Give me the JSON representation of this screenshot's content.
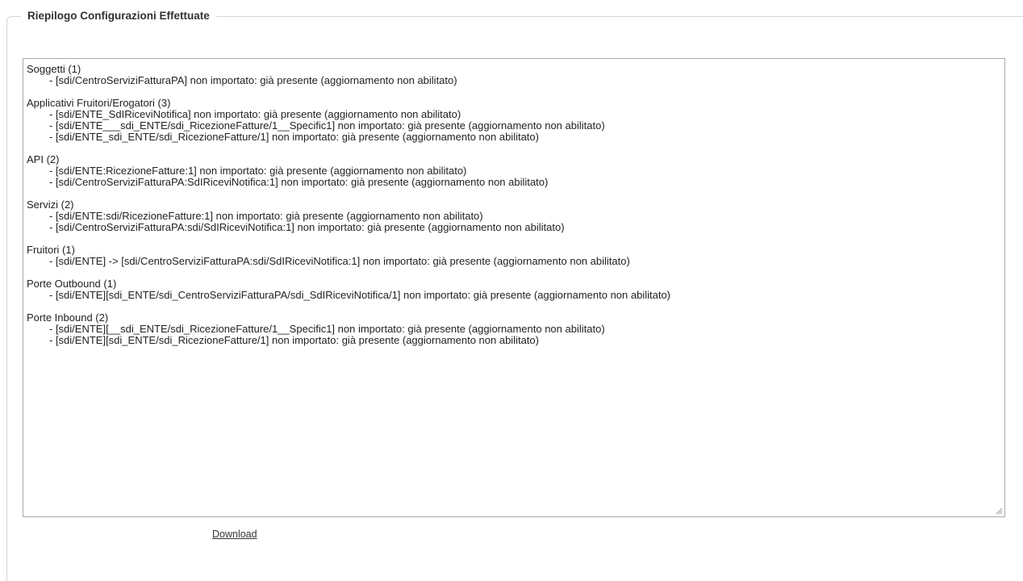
{
  "panel": {
    "legend": "Riepilogo Configurazioni Effettuate"
  },
  "summary": {
    "sections": [
      {
        "title": "Soggetti (1)",
        "items": [
          "- [sdi/CentroServiziFatturaPA] non importato: già presente (aggiornamento non abilitato)"
        ]
      },
      {
        "title": "Applicativi Fruitori/Erogatori (3)",
        "items": [
          "- [sdi/ENTE_SdIRiceviNotifica] non importato: già presente (aggiornamento non abilitato)",
          "- [sdi/ENTE___sdi_ENTE/sdi_RicezioneFatture/1__Specific1] non importato: già presente (aggiornamento non abilitato)",
          "- [sdi/ENTE_sdi_ENTE/sdi_RicezioneFatture/1] non importato: già presente (aggiornamento non abilitato)"
        ]
      },
      {
        "title": "API (2)",
        "items": [
          "- [sdi/ENTE:RicezioneFatture:1] non importato: già presente (aggiornamento non abilitato)",
          "- [sdi/CentroServiziFatturaPA:SdIRiceviNotifica:1] non importato: già presente (aggiornamento non abilitato)"
        ]
      },
      {
        "title": "Servizi (2)",
        "items": [
          "- [sdi/ENTE:sdi/RicezioneFatture:1] non importato: già presente (aggiornamento non abilitato)",
          "- [sdi/CentroServiziFatturaPA:sdi/SdIRiceviNotifica:1] non importato: già presente (aggiornamento non abilitato)"
        ]
      },
      {
        "title": "Fruitori (1)",
        "items": [
          "- [sdi/ENTE] -> [sdi/CentroServiziFatturaPA:sdi/SdIRiceviNotifica:1] non importato: già presente (aggiornamento non abilitato)"
        ]
      },
      {
        "title": "Porte Outbound (1)",
        "items": [
          "- [sdi/ENTE][sdi_ENTE/sdi_CentroServiziFatturaPA/sdi_SdIRiceviNotifica/1] non importato: già presente (aggiornamento non abilitato)"
        ]
      },
      {
        "title": "Porte Inbound (2)",
        "items": [
          "- [sdi/ENTE][__sdi_ENTE/sdi_RicezioneFatture/1__Specific1] non importato: già presente (aggiornamento non abilitato)",
          "- [sdi/ENTE][sdi_ENTE/sdi_RicezioneFatture/1] non importato: già presente (aggiornamento non abilitato)"
        ]
      }
    ],
    "resize_icon": "resize-grip-icon"
  },
  "actions": {
    "download_label": "Download"
  }
}
